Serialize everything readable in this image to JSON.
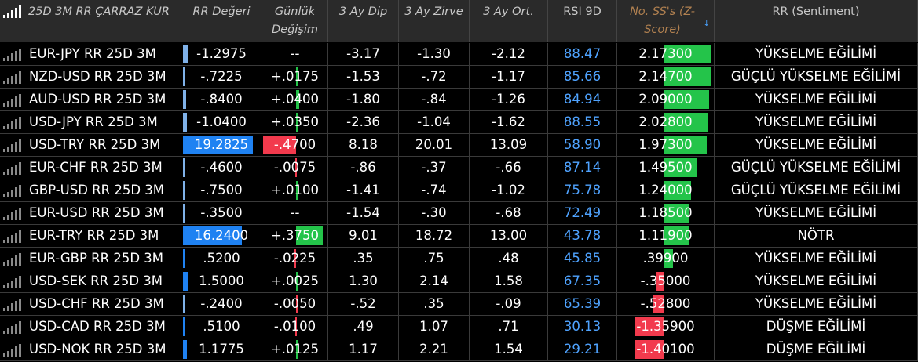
{
  "header": {
    "columns": [
      {
        "key": "kur",
        "label": "25D 3M RR ÇARRAZ KUR"
      },
      {
        "key": "rr",
        "label": "RR Değeri"
      },
      {
        "key": "chg",
        "label": "Günlük Değişim"
      },
      {
        "key": "low",
        "label": "3 Ay Dip"
      },
      {
        "key": "high",
        "label": "3 Ay Zirve"
      },
      {
        "key": "avg",
        "label": "3 Ay Ort."
      },
      {
        "key": "rsi",
        "label": "RSI 9D"
      },
      {
        "key": "z",
        "label": "No. SS's (Z-Score)",
        "sort_icon": "sort-descending-icon"
      },
      {
        "key": "sent",
        "label": "RR (Sentiment)"
      }
    ]
  },
  "colors": {
    "header_bg": "#2a2a2a",
    "header_text": "#c8c8c8",
    "sorted_header_text": "#b08050",
    "rsi_text": "#4fa3ff",
    "bar_blue": "#1f82f2",
    "bar_green": "#24c44a",
    "bar_red": "#f23a4d"
  },
  "rows": [
    {
      "kur": "EUR-JPY RR 25D 3M",
      "rr": "-1.2975",
      "rr_num": -1.2975,
      "chg": "--",
      "chg_num": 0,
      "low": "-3.17",
      "high": "-1.30",
      "avg": "-2.12",
      "rsi": "88.47",
      "z": "2.17300",
      "z_num": 2.173,
      "sent": "YÜKSELME EĞİLİMİ"
    },
    {
      "kur": "NZD-USD RR 25D 3M",
      "rr": "-.7225",
      "rr_num": -0.7225,
      "chg": "+.0175",
      "chg_num": 0.0175,
      "low": "-1.53",
      "high": "-.72",
      "avg": "-1.17",
      "rsi": "85.66",
      "z": "2.14700",
      "z_num": 2.147,
      "sent": "GÜÇLÜ YÜKSELME EĞİLİMİ"
    },
    {
      "kur": "AUD-USD RR 25D 3M",
      "rr": "-.8400",
      "rr_num": -0.84,
      "chg": "+.0400",
      "chg_num": 0.04,
      "low": "-1.80",
      "high": "-.84",
      "avg": "-1.26",
      "rsi": "84.94",
      "z": "2.09000",
      "z_num": 2.09,
      "sent": "YÜKSELME EĞİLİMİ"
    },
    {
      "kur": "USD-JPY RR 25D 3M",
      "rr": "-1.0400",
      "rr_num": -1.04,
      "chg": "+.0350",
      "chg_num": 0.035,
      "low": "-2.36",
      "high": "-1.04",
      "avg": "-1.62",
      "rsi": "88.55",
      "z": "2.02800",
      "z_num": 2.028,
      "sent": "YÜKSELME EĞİLİMİ"
    },
    {
      "kur": "USD-TRY RR 25D 3M",
      "rr": "19.2825",
      "rr_num": 19.2825,
      "chg": "-.4700",
      "chg_num": -0.47,
      "low": "8.18",
      "high": "20.01",
      "avg": "13.09",
      "rsi": "58.90",
      "z": "1.97300",
      "z_num": 1.973,
      "sent": "YÜKSELME EĞİLİMİ"
    },
    {
      "kur": "EUR-CHF RR 25D 3M",
      "rr": "-.4600",
      "rr_num": -0.46,
      "chg": "-.0075",
      "chg_num": -0.0075,
      "low": "-.86",
      "high": "-.37",
      "avg": "-.66",
      "rsi": "87.14",
      "z": "1.49500",
      "z_num": 1.495,
      "sent": "GÜÇLÜ YÜKSELME EĞİLİMİ"
    },
    {
      "kur": "GBP-USD RR 25D 3M",
      "rr": "-.7500",
      "rr_num": -0.75,
      "chg": "+.0100",
      "chg_num": 0.01,
      "low": "-1.41",
      "high": "-.74",
      "avg": "-1.02",
      "rsi": "75.78",
      "z": "1.24000",
      "z_num": 1.24,
      "sent": "GÜÇLÜ YÜKSELME EĞİLİMİ"
    },
    {
      "kur": "EUR-USD RR 25D 3M",
      "rr": "-.3500",
      "rr_num": -0.35,
      "chg": "--",
      "chg_num": 0,
      "low": "-1.54",
      "high": "-.30",
      "avg": "-.68",
      "rsi": "72.49",
      "z": "1.18500",
      "z_num": 1.185,
      "sent": "YÜKSELME EĞİLİMİ"
    },
    {
      "kur": "EUR-TRY RR 25D 3M",
      "rr": "16.2400",
      "rr_num": 16.24,
      "chg": "+.3750",
      "chg_num": 0.375,
      "low": "9.01",
      "high": "18.72",
      "avg": "13.00",
      "rsi": "43.78",
      "z": "1.11900",
      "z_num": 1.119,
      "sent": "NÖTR"
    },
    {
      "kur": "EUR-GBP RR 25D 3M",
      "rr": ".5200",
      "rr_num": 0.52,
      "chg": "-.0225",
      "chg_num": -0.0225,
      "low": ".35",
      "high": ".75",
      "avg": ".48",
      "rsi": "45.85",
      "z": ".39900",
      "z_num": 0.399,
      "sent": "YÜKSELME EĞİLİMİ"
    },
    {
      "kur": "USD-SEK RR 25D 3M",
      "rr": "1.5000",
      "rr_num": 1.5,
      "chg": "+.0025",
      "chg_num": 0.0025,
      "low": "1.30",
      "high": "2.14",
      "avg": "1.58",
      "rsi": "67.35",
      "z": "-.35000",
      "z_num": -0.35,
      "sent": "YÜKSELME EĞİLİMİ"
    },
    {
      "kur": "USD-CHF RR 25D 3M",
      "rr": "-.2400",
      "rr_num": -0.24,
      "chg": "-.0050",
      "chg_num": -0.005,
      "low": "-.52",
      "high": ".35",
      "avg": "-.09",
      "rsi": "65.39",
      "z": "-.52800",
      "z_num": -0.528,
      "sent": "YÜKSELME EĞİLİMİ"
    },
    {
      "kur": "USD-CAD RR 25D 3M",
      "rr": ".5100",
      "rr_num": 0.51,
      "chg": "-.0100",
      "chg_num": -0.01,
      "low": ".49",
      "high": "1.07",
      "avg": ".71",
      "rsi": "30.13",
      "z": "-1.35900",
      "z_num": -1.359,
      "sent": "DÜŞME EĞİLİMİ"
    },
    {
      "kur": "USD-NOK RR 25D 3M",
      "rr": "1.1775",
      "rr_num": 1.1775,
      "chg": "+.0125",
      "chg_num": 0.0125,
      "low": "1.17",
      "high": "2.21",
      "avg": "1.54",
      "rsi": "29.21",
      "z": "-1.40100",
      "z_num": -1.401,
      "sent": "DÜŞME EĞİLİMİ"
    }
  ]
}
